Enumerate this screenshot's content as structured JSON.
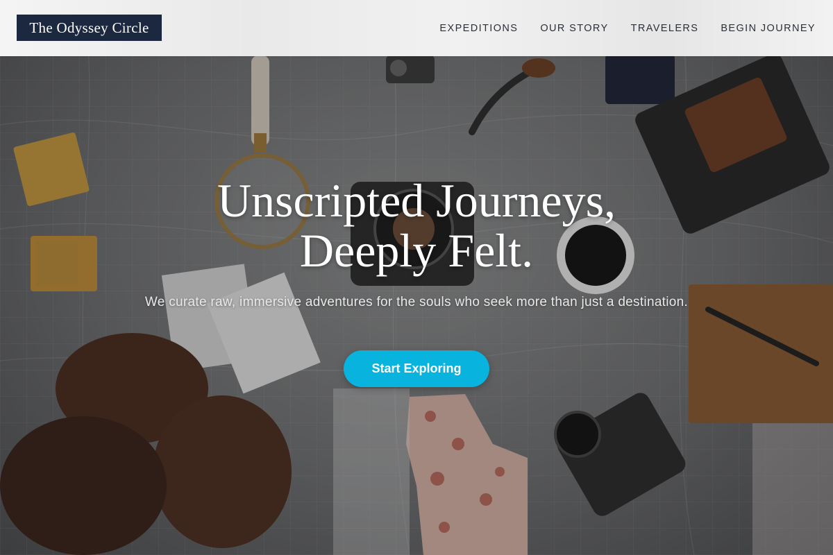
{
  "header": {
    "logo_text": "The Odyssey Circle",
    "nav": [
      {
        "label": "EXPEDITIONS"
      },
      {
        "label": "OUR STORY"
      },
      {
        "label": "TRAVELERS"
      },
      {
        "label": "BEGIN JOURNEY"
      }
    ]
  },
  "hero": {
    "title_line1": "Unscripted Journeys,",
    "title_line2": "Deeply Felt.",
    "subtitle": "We curate raw, immersive adventures for the souls who seek more than just a destination.",
    "cta_label": "Start Exploring",
    "background_image": "travel flat lay on map with boots, cameras, coffee, magnifying glass, notebook"
  },
  "colors": {
    "brand_navy": "#1c2740",
    "accent_cyan": "#08b3dd",
    "header_bg": "#f0f0f0"
  }
}
